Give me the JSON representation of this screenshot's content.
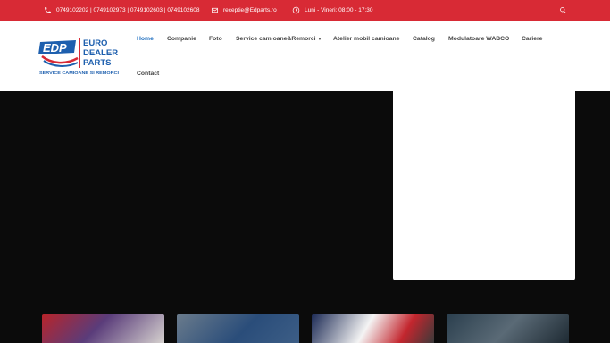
{
  "topbar": {
    "phone": "0749102202 | 0749102973 | 0749102603 | 0749102608",
    "email": "receptie@Edparts.ro",
    "hours": "Luni - Vineri: 08:00 - 17:30"
  },
  "logo": {
    "letters": "EDP",
    "line1": "EURO",
    "line2": "DEALER",
    "line3": "PARTS",
    "tagline": "SERVICE CAMIOANE SI REMORCI"
  },
  "nav": {
    "items": [
      "Home",
      "Companie",
      "Foto",
      "Service camioane&Remorci",
      "Atelier mobil camioane",
      "Catalog",
      "Modulatoare WABCO",
      "Cariere",
      "Contact"
    ]
  },
  "colors": {
    "topbar": "#d82a35",
    "nav_active": "#1f6fc0",
    "logo_blue": "#1d5fae",
    "logo_red": "#d82a35",
    "hero_bg": "#0b0b0b"
  }
}
